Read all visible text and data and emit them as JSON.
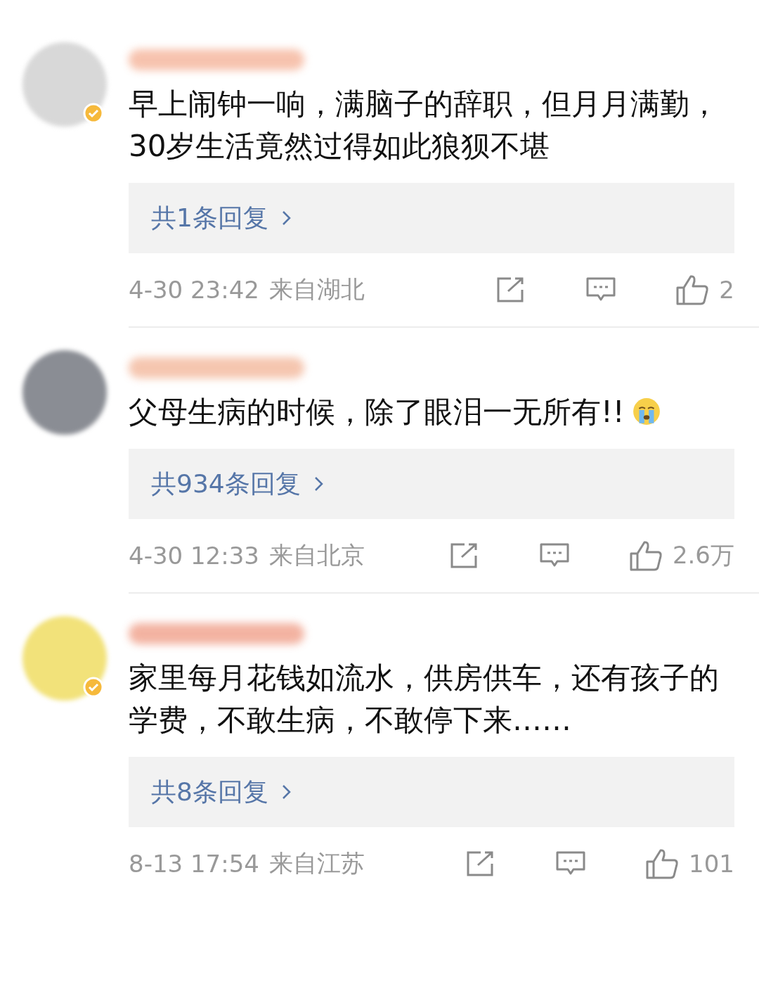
{
  "comments": [
    {
      "verified": true,
      "text": "早上闹钟一响，满脑子的辞职，但月月满勤，30岁生活竟然过得如此狼狈不堪",
      "emoji": false,
      "replies": "共1条回复",
      "time": "4-30 23:42",
      "location": "来自湖北",
      "likes": "2"
    },
    {
      "verified": false,
      "text": "父母生病的时候，除了眼泪一无所有!!",
      "emoji": true,
      "replies": "共934条回复",
      "time": "4-30 12:33",
      "location": "来自北京",
      "likes": "2.6万"
    },
    {
      "verified": true,
      "text": "家里每月花钱如流水，供房供车，还有孩子的学费，不敢生病，不敢停下来……",
      "emoji": false,
      "replies": "共8条回复",
      "time": "8-13 17:54",
      "location": "来自江苏",
      "likes": "101"
    }
  ]
}
